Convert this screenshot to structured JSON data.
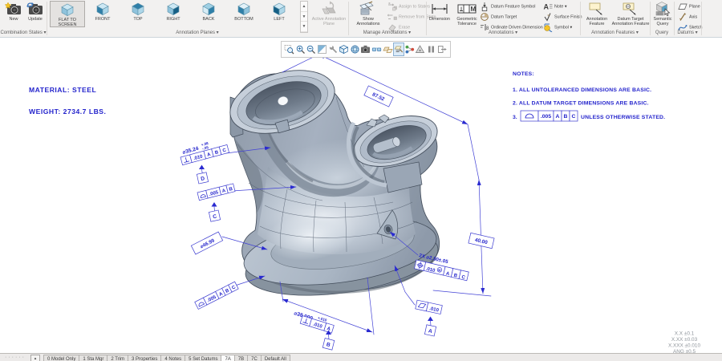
{
  "colors": {
    "pmi_blue": "#2323cc",
    "ribbon_bg": "#f2f1f0",
    "canvas_bg": "#ffffff",
    "model_mid": "#9fabbb",
    "model_light": "#c6cfda",
    "model_dark": "#5a6572",
    "tolerance_gray": "#9aa0a6"
  },
  "ribbon": {
    "combination_states": {
      "label": "Combination States ▾",
      "new_btn": "New",
      "update_btn": "Update"
    },
    "annotation_planes": {
      "label": "Annotation Planes ▾",
      "views": [
        "FLAT TO SCREEN",
        "FRONT",
        "TOP",
        "RIGHT",
        "BACK",
        "BOTTOM",
        "LEFT"
      ],
      "active_plane": "Active Annotation Plane"
    },
    "manage_annotations": {
      "label": "Manage Annotations ▾",
      "show_annotations": "Show Annotations",
      "assign_to_states": "Assign to States",
      "remove_from_state": "Remove from State",
      "erase": "Erase"
    },
    "annotations": {
      "label": "Annotations ▾",
      "dimension": "Dimension",
      "geometric_tolerance": "Geometric Tolerance",
      "datum_feature_symbol": "Datum Feature Symbol",
      "datum_target": "Datum Target",
      "ordinate_driven_dimension": "Ordinate Driven Dimension",
      "note": "Note ▾",
      "surface_finish": "Surface Finish",
      "symbol": "Symbol ▾"
    },
    "annotation_features": {
      "label": "Annotation Features ▾",
      "annotation_feature": "Annotation Feature",
      "datum_target_annotation_feature": "Datum Target Annotation Feature"
    },
    "query": {
      "label": "Query",
      "semantic_query": "Semantic Query"
    },
    "datums": {
      "label": "Datums ▾",
      "plane": "Plane",
      "axis": "Axis",
      "sketch": "Sketch"
    }
  },
  "icons": {
    "scroll_up": "▲",
    "scroll_down": "▼",
    "gallery_expand": "▼",
    "statusbar_grip": "······",
    "statusbar_expand": "▴"
  },
  "graphics_toolbar": {
    "icons": [
      "zoom-region",
      "zoom-in",
      "zoom-out",
      "repaint",
      "utilities",
      "display-style",
      "saved-views",
      "capture",
      "view-mode",
      "datum-display",
      "annotation-display",
      "model-tree-nodes",
      "spin-center",
      "pause",
      "exit-view"
    ]
  },
  "canvas": {
    "material_note": "MATERIAL: STEEL",
    "weight_note": "WEIGHT: 2734.7 LBS.",
    "notes": {
      "title": "NOTES:",
      "note1": "1. ALL UNTOLERANCED DIMENSIONS ARE BASIC.",
      "note2": "2. ALL DATUM TARGET DIMENSIONS ARE BASIC.",
      "note3_prefix": "3.",
      "note3_fcf": {
        "tolerance": ".005",
        "d1": "A",
        "d2": "B",
        "d3": "C"
      },
      "note3_suffix": "UNLESS OTHERWISE STATED."
    },
    "default_tolerances": {
      "line1": "X.X ±0.1",
      "line2": "X.XX ±0.03",
      "line3": "X.XXX ±0.010",
      "line4": "ANG ±0.5"
    },
    "pmi": {
      "dia3524": {
        "text": "⌀35.24",
        "tol_plus": "+.08",
        "tol_minus": "-.05",
        "fcf": {
          "tolerance": ".010",
          "d1": "A",
          "d2": "B",
          "d3": "C"
        },
        "datum": "D"
      },
      "prof005ab": {
        "tolerance": ".005",
        "d1": "A",
        "d2": "B",
        "datum": "C"
      },
      "dia4699": {
        "text": "⌀46.99"
      },
      "prof005abc": {
        "tolerance": ".005",
        "d1": "A",
        "d2": "B",
        "d3": "C"
      },
      "dia38000": {
        "text": "⌀38.000",
        "tol_plus": "+.010",
        "tol_minus": "-.005",
        "fcf": {
          "tolerance": ".010",
          "d1": "A"
        },
        "datum": "B"
      },
      "holes250": {
        "text": "2X ⌀2.50±.05",
        "fcf": {
          "tolerance": ".010",
          "modifier": "M",
          "d1": "A",
          "d2": "B",
          "d3": "C"
        }
      },
      "dim8752": {
        "text": "87.52"
      },
      "dim4000": {
        "text": "40.00"
      },
      "flat010": {
        "tolerance": ".010",
        "datum": "A"
      }
    }
  },
  "status_bar": {
    "tabs": [
      "0 Model Only",
      "1 Sta Mgr",
      "2 Trim",
      "3 Properties",
      "4 Notes",
      "5 Set Datums",
      "7A",
      "7B",
      "7C",
      "Default All"
    ],
    "active_tab": "7A"
  }
}
